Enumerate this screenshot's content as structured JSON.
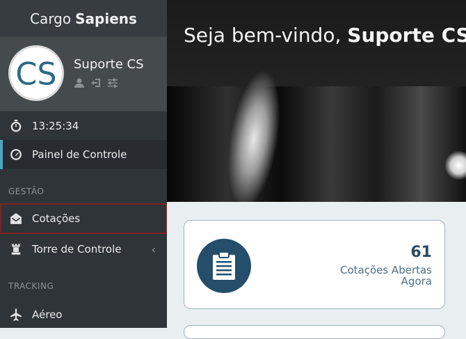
{
  "sidebar": {
    "brand": {
      "light": "Cargo",
      "bold": "Sapiens"
    },
    "profile": {
      "name": "Suporte CS",
      "avatar_initials": "CS"
    },
    "clock": "13:25:34",
    "items": {
      "painel": "Painel de Controle",
      "gestao_section": "GESTÃO",
      "cotacoes": "Cotações",
      "torre": "Torre de Controle",
      "tracking_section": "TRACKING",
      "aereo": "Aéreo"
    }
  },
  "hero": {
    "welcome": "Seja bem-vindo,",
    "user": "Suporte CS"
  },
  "card": {
    "count": "61",
    "label": "Cotações Abertas Agora"
  },
  "colors": {
    "accent": "#48a7c3",
    "sidebar": "#2f3438",
    "card_icon_bg": "#254e6a",
    "highlight_border": "#7b2323"
  }
}
